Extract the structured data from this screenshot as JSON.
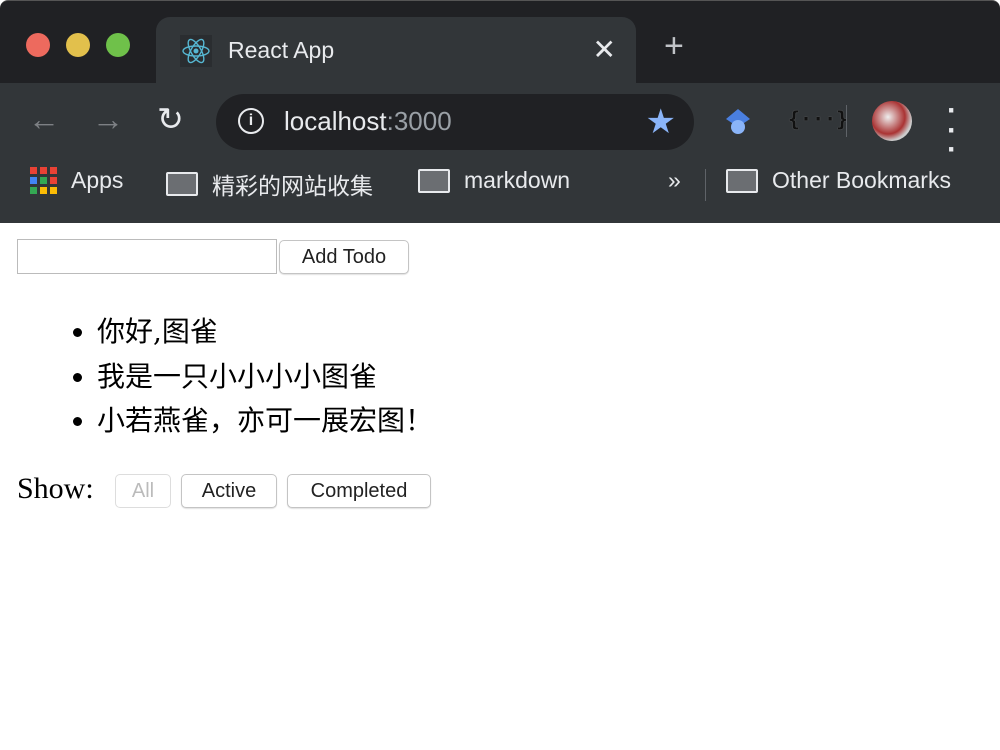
{
  "browser": {
    "tab_title": "React App",
    "url_host": "localhost",
    "url_port": ":3000",
    "bookmarks": [
      {
        "label": "Apps"
      },
      {
        "label": "精彩的网站收集"
      },
      {
        "label": "markdown"
      }
    ],
    "overflow": "»",
    "other_bookmarks": "Other Bookmarks",
    "extension_json": "{···}"
  },
  "app": {
    "input_value": "",
    "add_button": "Add Todo",
    "todos": [
      "你好,图雀",
      "我是一只小小小小图雀",
      "小若燕雀，亦可一展宏图！"
    ],
    "filter_label": "Show:",
    "filters": [
      {
        "label": "All",
        "active": true
      },
      {
        "label": "Active"
      },
      {
        "label": "Completed"
      }
    ]
  }
}
